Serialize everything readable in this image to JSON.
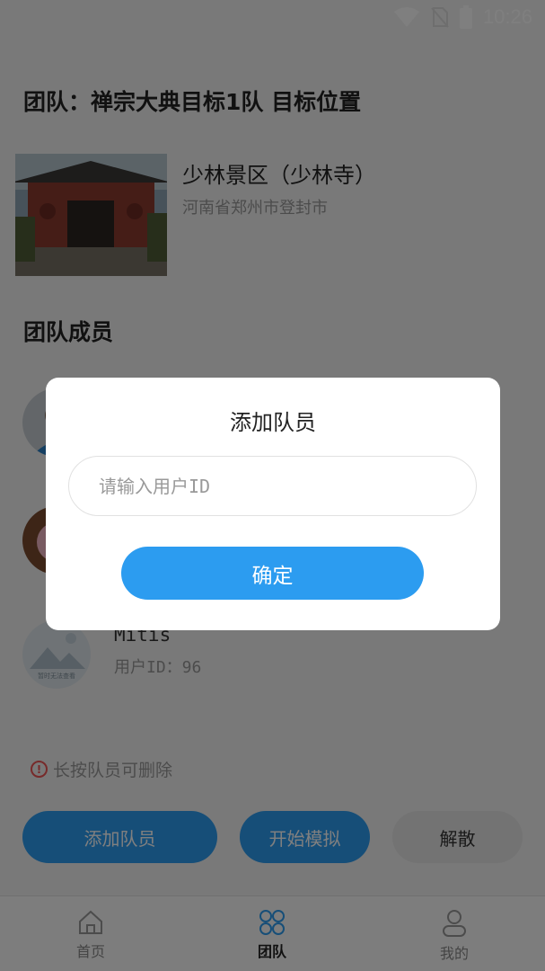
{
  "status_bar": {
    "time": "10:26"
  },
  "header": {
    "title": "团队：禅宗大典目标1队  目标位置"
  },
  "location": {
    "name": "少林景区（少林寺）",
    "address": "河南省郑州市登封市"
  },
  "members_section": {
    "title": "团队成员",
    "members": [
      {
        "name": "",
        "user_id": ""
      },
      {
        "name": "",
        "user_id": ""
      },
      {
        "name": "Mitis",
        "user_id": "用户ID：96",
        "avatar_caption": "暂时无法查看"
      }
    ]
  },
  "hint": {
    "text": "长按队员可删除"
  },
  "actions": {
    "add_label": "添加队员",
    "simulate_label": "开始模拟",
    "disband_label": "解散"
  },
  "tabbar": {
    "items": [
      {
        "label": "首页"
      },
      {
        "label": "团队"
      },
      {
        "label": "我的"
      }
    ],
    "active": "团队"
  },
  "dialog": {
    "title": "添加队员",
    "input_placeholder": "请输入用户ID",
    "input_value": "",
    "confirm_label": "确定"
  },
  "colors": {
    "accent": "#2c9cf0",
    "overlay": "rgba(0,0,0,0.5)",
    "hint_icon": "#e55555"
  }
}
